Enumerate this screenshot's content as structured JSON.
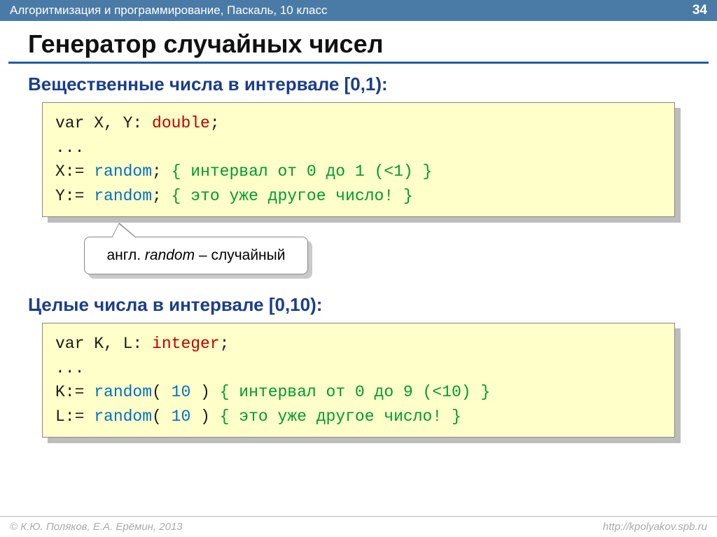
{
  "header": {
    "breadcrumb": "Алгоритмизация и программирование, Паскаль, 10 класс",
    "page_number": "34"
  },
  "title": "Генератор случайных чисел",
  "section1": {
    "heading": "Вещественные числа в интервале [0,1):",
    "code": {
      "l1_var": "var",
      "l1_ids": " X, Y: ",
      "l1_type": "double",
      "l1_semi": ";",
      "l2": "...",
      "l3_lhs": "X:= ",
      "l3_fn": "random",
      "l3_semi": ";",
      "l3_comm": " { интервал от 0 до 1 (<1) }",
      "l4_lhs": "Y:= ",
      "l4_fn": "random",
      "l4_semi": ";",
      "l4_comm": " { это уже другое число! }"
    }
  },
  "note": {
    "prefix": "англ. ",
    "word": "random",
    "suffix": " – случайный"
  },
  "section2": {
    "heading": "Целые числа в интервале [0,10):",
    "code": {
      "l1_var": "var",
      "l1_ids": " K, L: ",
      "l1_type": "integer",
      "l1_semi": ";",
      "l2": "...",
      "l3_lhs": "K:= ",
      "l3_fn": "random",
      "l3_open": "(",
      "l3_arg": " 10 ",
      "l3_close": ")",
      "l3_comm": " { интервал от 0 до 9 (<10) }",
      "l4_lhs": "L:= ",
      "l4_fn": "random",
      "l4_open": "(",
      "l4_arg": " 10 ",
      "l4_close": ")",
      "l4_comm": " { это уже другое число! }"
    }
  },
  "footer": {
    "copyright": "© К.Ю. Поляков, Е.А. Ерёмин, 2013",
    "url": "http://kpolyakov.spb.ru"
  }
}
